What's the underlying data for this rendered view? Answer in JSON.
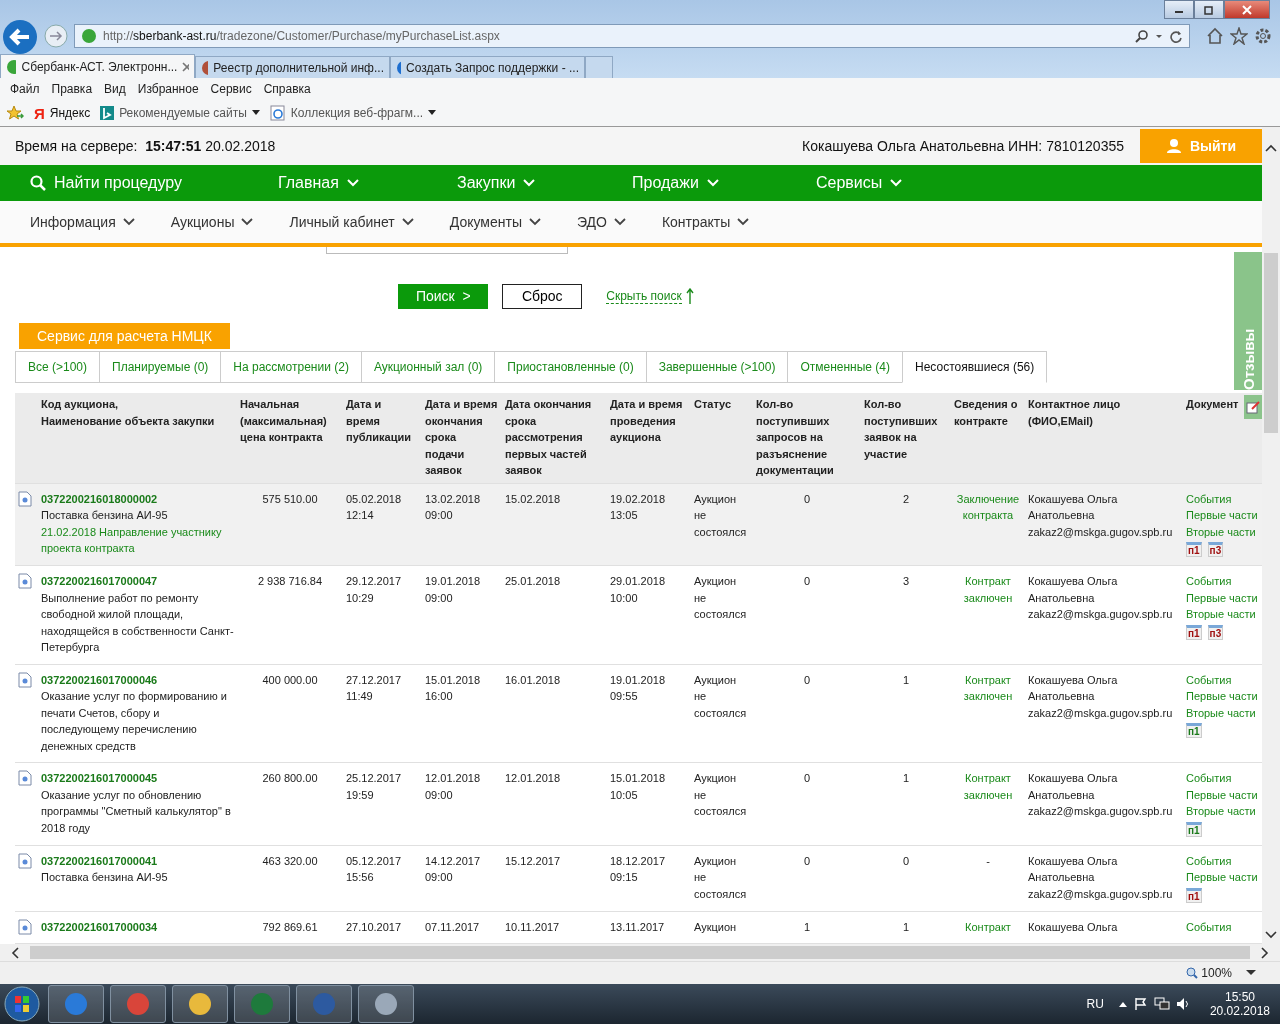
{
  "browser": {
    "url_host": "sberbank-ast.ru",
    "url_path": "/tradezone/Customer/Purchase/myPurchaseList.aspx",
    "url_scheme": "http://",
    "tabs": [
      {
        "label": "Сбербанк-АСТ. Электронн...",
        "kind": "sber",
        "selected": true
      },
      {
        "label": "Реестр дополнительной инф...",
        "kind": "emblem",
        "selected": false
      },
      {
        "label": "Создать Запрос поддержки - ...",
        "kind": "help",
        "selected": false
      }
    ],
    "menu": [
      "Файл",
      "Правка",
      "Вид",
      "Избранное",
      "Сервис",
      "Справка"
    ],
    "favorites": [
      {
        "kind": "yandex",
        "logo": "Я",
        "label": "Яндекс"
      },
      {
        "kind": "bing",
        "label": "Рекомендуемые сайты"
      },
      {
        "kind": "ie",
        "label": "Коллекция веб-фрагм..."
      }
    ],
    "zoom": "100%"
  },
  "header": {
    "server_time": "Время на сервере:  **15:47:51** 20.02.2018",
    "user": "Кокашуева Ольга Анатольевна ИНН: 7810120355",
    "logout": "Выйти"
  },
  "main_nav": [
    {
      "label": "Найти процедуру",
      "kind": "search"
    },
    {
      "label": "Главная",
      "kind": "menu"
    },
    {
      "label": "Закупки",
      "kind": "menu"
    },
    {
      "label": "Продажи",
      "kind": "menu"
    },
    {
      "label": "Сервисы",
      "kind": "menu"
    }
  ],
  "sub_nav": [
    "Информация",
    "Аукционы",
    "Личный кабинет",
    "Документы",
    "ЭДО",
    "Контракты"
  ],
  "search_actions": {
    "search": "Поиск  >",
    "reset": "Сброс",
    "hide": "Скрыть поиск"
  },
  "nmck_button": "Сервис для расчета НМЦК",
  "feedback_tab": "Отзывы",
  "filter_tabs": [
    {
      "label": "Все (>100)",
      "selected": false
    },
    {
      "label": "Планируемые (0)",
      "selected": false
    },
    {
      "label": "На рассмотрении (2)",
      "selected": false
    },
    {
      "label": "Аукционный зал (0)",
      "selected": false
    },
    {
      "label": "Приостановленные (0)",
      "selected": false
    },
    {
      "label": "Завершенные (>100)",
      "selected": false
    },
    {
      "label": "Отмененные (4)",
      "selected": false
    },
    {
      "label": "Несостоявшиеся (56)",
      "selected": true
    }
  ],
  "table": {
    "columns": [
      "Код аукциона,\nНаименование объекта закупки",
      "Начальная\n(максимальная)\nцена контракта",
      "Дата и\nвремя\nпубликации",
      "Дата и время\nокончания\nсрока\nподачи\nзаявок",
      "Дата окончания\nсрока\nрассмотрения\nпервых частей\nзаявок",
      "Дата и время\nпроведения\nаукциона",
      "Статус",
      "Кол-во\nпоступивших\nзапросов на\nразъяснение\nдокументации",
      "Кол-во\nпоступивших\nзаявок на\nучастие",
      "Сведения о\nконтракте",
      "Контактное лицо\n(ФИО,EMail)",
      "Документ"
    ],
    "rows": [
      {
        "highlighted": true,
        "code": "0372200216018000002",
        "name": "Поставка бензина АИ-95",
        "note": "21.02.2018 Направление участнику проекта контракта",
        "price": "575 510.00",
        "published": "05.02.2018\n12:14",
        "submission_end": "13.02.2018\n09:00",
        "review_end": "15.02.2018",
        "auction": "19.02.2018\n13:05",
        "status": "Аукцион\nне\nсостоялся",
        "requests": "0",
        "bids": "2",
        "contract": "Заключение контракта",
        "contract_link": true,
        "contact": "Кокашуева  Ольга\nАнатольевна",
        "email": "zakaz2@mskga.gugov.spb.ru",
        "docs": [
          "События",
          "Первые части",
          "Вторые части"
        ],
        "badges": [
          {
            "label": "п1",
            "color": "#a01010"
          },
          {
            "label": "п3",
            "color": "#a01010"
          }
        ]
      },
      {
        "highlighted": false,
        "code": "0372200216017000047",
        "name": "Выполнение работ по ремонту свободной жилой площади, находящейся в собственности Санкт-Петербурга",
        "price": "2 938 716.84",
        "published": "29.12.2017\n10:29",
        "submission_end": "19.01.2018\n09:00",
        "review_end": "25.01.2018",
        "auction": "29.01.2018\n10:00",
        "status": "Аукцион\nне\nсостоялся",
        "requests": "0",
        "bids": "3",
        "contract": "Контракт заключен",
        "contract_link": true,
        "contact": "Кокашуева  Ольга\nАнатольевна",
        "email": "zakaz2@mskga.gugov.spb.ru",
        "docs": [
          "События",
          "Первые части",
          "Вторые части"
        ],
        "badges": [
          {
            "label": "п1",
            "color": "#a01010"
          },
          {
            "label": "п3",
            "color": "#a01010"
          }
        ]
      },
      {
        "highlighted": false,
        "code": "0372200216017000046",
        "name": "Оказание услуг по формированию и печати Счетов, сбору и последующему перечислению денежных средств",
        "price": "400 000.00",
        "published": "27.12.2017\n11:49",
        "submission_end": "15.01.2018\n16:00",
        "review_end": "16.01.2018",
        "auction": "19.01.2018\n09:55",
        "status": "Аукцион\nне\nсостоялся",
        "requests": "0",
        "bids": "1",
        "contract": "Контракт заключен",
        "contract_link": true,
        "contact": "Кокашуева  Ольга\nАнатольевна",
        "email": "zakaz2@mskga.gugov.spb.ru",
        "docs": [
          "События",
          "Первые части",
          "Вторые части"
        ],
        "badges": [
          {
            "label": "п1",
            "color": "#1a7a1a"
          }
        ]
      },
      {
        "highlighted": false,
        "code": "0372200216017000045",
        "name": "Оказание услуг по обновлению программы \"Сметный калькулятор\" в 2018 году",
        "price": "260 800.00",
        "published": "25.12.2017\n19:59",
        "submission_end": "12.01.2018\n09:00",
        "review_end": "12.01.2018",
        "auction": "15.01.2018\n10:05",
        "status": "Аукцион\nне\nсостоялся",
        "requests": "0",
        "bids": "1",
        "contract": "Контракт заключен",
        "contract_link": true,
        "contact": "Кокашуева  Ольга\nАнатольевна",
        "email": "zakaz2@mskga.gugov.spb.ru",
        "docs": [
          "События",
          "Первые части",
          "Вторые части"
        ],
        "badges": [
          {
            "label": "п1",
            "color": "#1a7a1a"
          }
        ]
      },
      {
        "highlighted": false,
        "code": "0372200216017000041",
        "name": "Поставка бензина АИ-95",
        "price": "463 320.00",
        "published": "05.12.2017\n15:56",
        "submission_end": "14.12.2017\n09:00",
        "review_end": "15.12.2017",
        "auction": "18.12.2017\n09:15",
        "status": "Аукцион\nне\nсостоялся",
        "requests": "0",
        "bids": "0",
        "contract": "-",
        "contract_link": false,
        "contact": "Кокашуева  Ольга\nАнатольевна",
        "email": "zakaz2@mskga.gugov.spb.ru",
        "docs": [
          "События",
          "Первые части"
        ],
        "badges": [
          {
            "label": "п1",
            "color": "#a01010"
          }
        ]
      },
      {
        "highlighted": false,
        "code": "0372200216017000034",
        "price": "792 869.61",
        "published": "27.10.2017",
        "submission_end": "07.11.2017",
        "review_end": "10.11.2017",
        "auction": "13.11.2017",
        "status": "Аукцион",
        "requests": "1",
        "bids": "1",
        "contract": "Контракт",
        "contract_link": true,
        "contact": "Кокашуева  Ольга",
        "docs": [
          "События"
        ]
      }
    ]
  },
  "taskbar": {
    "apps": [
      {
        "kind": "ie"
      },
      {
        "kind": "chrome"
      },
      {
        "kind": "folder"
      },
      {
        "kind": "excel"
      },
      {
        "kind": "mail"
      },
      {
        "kind": "scanner"
      }
    ],
    "language": "RU",
    "time": "15:50",
    "date": "20.02.2018"
  }
}
